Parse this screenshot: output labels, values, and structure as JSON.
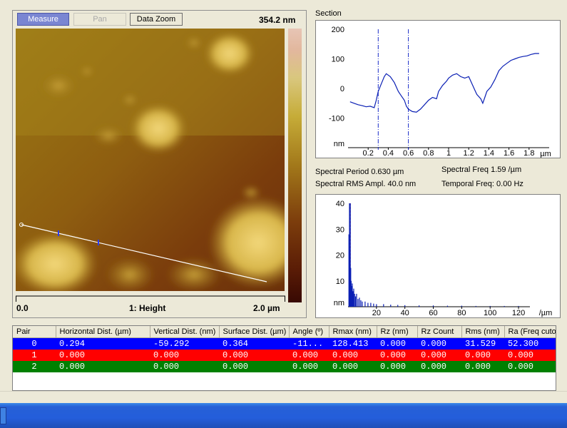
{
  "toolbar": {
    "measure_label": "Measure",
    "pan_label": "Pan",
    "zoom_label": "Data Zoom"
  },
  "image_panel": {
    "zscale_label": "354.2 nm",
    "x_start": "0.0",
    "channel_label": "1: Height",
    "x_end": "2.0 µm"
  },
  "section": {
    "title": "Section",
    "spectral_period": "Spectral Period 0.630 µm",
    "spectral_freq": "Spectral Freq 1.59 /µm",
    "spectral_rms": "Spectral RMS Ampl. 40.0 nm",
    "temporal_freq": "Temporal Freq: 0.00 Hz"
  },
  "colors": {
    "line": "#0a1fb4",
    "cursor": "#1a2cc8",
    "spectrum_peak": "#d01010",
    "row_blue": "#0000ff",
    "row_red": "#ff0000",
    "row_green": "#008000"
  },
  "table": {
    "headers": [
      "Pair",
      "Horizontal Dist. (µm)",
      "Vertical Dist. (nm)",
      "Surface Dist. (µm)",
      "Angle (º)",
      "Rmax (nm)",
      "Rz (nm)",
      "Rz Count",
      "Rms (nm)",
      "Ra (Freq cutoff) (nm)"
    ],
    "rows": [
      {
        "color": "#0000ff",
        "cells": [
          "0",
          "0.294",
          "-59.292",
          "0.364",
          "-11...",
          "128.413",
          "0.000",
          "0.000",
          "31.529",
          "52.300"
        ]
      },
      {
        "color": "#ff0000",
        "cells": [
          "1",
          "0.000",
          "0.000",
          "0.000",
          "0.000",
          "0.000",
          "0.000",
          "0.000",
          "0.000",
          "0.000"
        ]
      },
      {
        "color": "#008000",
        "cells": [
          "2",
          "0.000",
          "0.000",
          "0.000",
          "0.000",
          "0.000",
          "0.000",
          "0.000",
          "0.000",
          "0.000"
        ]
      }
    ]
  },
  "chart_data": [
    {
      "type": "line",
      "ylabel": "nm",
      "xlabel": "µm",
      "xlim": [
        0.0,
        2.0
      ],
      "ylim": [
        -200,
        200
      ],
      "xticks": [
        0.2,
        0.4,
        0.6,
        0.8,
        1,
        1.2,
        1.4,
        1.6,
        1.8
      ],
      "yticks": [
        200,
        100,
        0,
        -100
      ],
      "cursors_x": [
        0.3,
        0.6
      ],
      "series": [
        {
          "x": [
            0.02,
            0.06,
            0.1,
            0.14,
            0.18,
            0.22,
            0.26,
            0.28,
            0.3,
            0.33,
            0.36,
            0.38,
            0.42,
            0.46,
            0.5,
            0.53,
            0.56,
            0.58,
            0.6,
            0.64,
            0.68,
            0.72,
            0.76,
            0.8,
            0.84,
            0.88,
            0.9,
            0.94,
            0.98,
            1.0,
            1.04,
            1.08,
            1.12,
            1.16,
            1.2,
            1.24,
            1.28,
            1.32,
            1.34,
            1.36,
            1.38,
            1.42,
            1.46,
            1.5,
            1.54,
            1.58,
            1.62,
            1.66,
            1.7,
            1.74,
            1.78,
            1.82,
            1.86,
            1.9
          ],
          "values": [
            -45,
            -50,
            -55,
            -58,
            -62,
            -60,
            -65,
            -40,
            -10,
            15,
            40,
            50,
            40,
            20,
            -10,
            -25,
            -40,
            -60,
            -70,
            -78,
            -80,
            -70,
            -55,
            -40,
            -30,
            -35,
            -10,
            10,
            25,
            35,
            45,
            50,
            40,
            35,
            40,
            10,
            -20,
            -35,
            -50,
            -30,
            -10,
            5,
            30,
            60,
            75,
            85,
            95,
            100,
            105,
            108,
            110,
            115,
            118,
            118
          ]
        }
      ]
    },
    {
      "type": "bar",
      "ylabel": "nm",
      "xlabel": "/µm",
      "xlim": [
        0,
        128
      ],
      "ylim": [
        0,
        40
      ],
      "xticks": [
        20,
        40,
        60,
        80,
        100,
        120
      ],
      "yticks": [
        40,
        30,
        20,
        10
      ],
      "peak_x": 1.59,
      "x": [
        0.6,
        1.0,
        1.3,
        1.59,
        1.9,
        2.2,
        2.6,
        3,
        3.5,
        4,
        4.6,
        5.3,
        6,
        7,
        8,
        9,
        10,
        12,
        14,
        16,
        18,
        20,
        25,
        30,
        35,
        40,
        50,
        60,
        70,
        80,
        90,
        100,
        110,
        120
      ],
      "values": [
        28,
        40,
        22,
        40,
        15,
        10,
        8,
        9,
        6,
        7,
        5,
        4,
        5,
        3,
        3.5,
        2.5,
        2,
        2,
        1.5,
        1.5,
        1.2,
        1,
        1,
        0.8,
        0.7,
        0.6,
        0.5,
        0.5,
        0.4,
        0.4,
        0.3,
        0.3,
        0.3,
        0.3
      ]
    }
  ]
}
